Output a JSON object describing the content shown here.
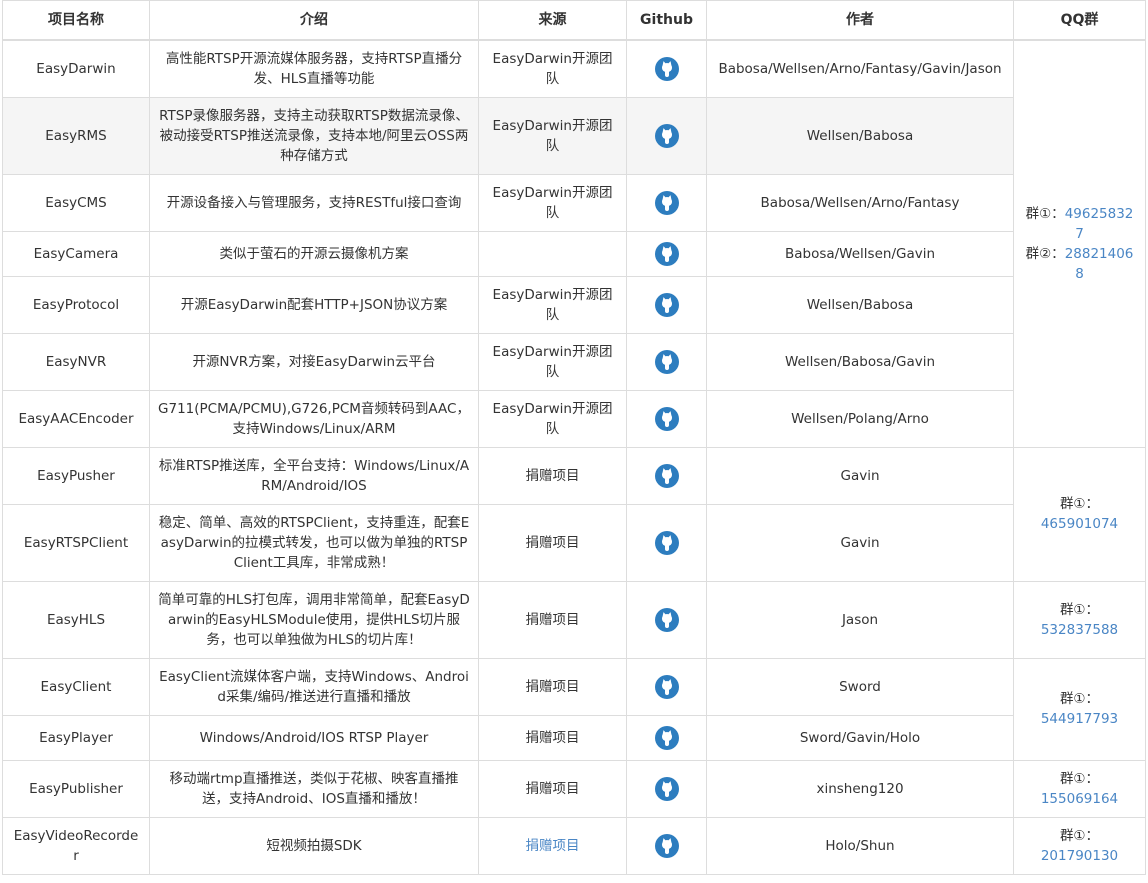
{
  "headers": [
    "项目名称",
    "介绍",
    "来源",
    "Github",
    "作者",
    "QQ群"
  ],
  "rows": [
    {
      "name": "EasyDarwin",
      "intro": "高性能RTSP开源流媒体服务器，支持RTSP直播分发、HLS直播等功能",
      "source": "EasyDarwin开源团队",
      "author": "Babosa/Wellsen/Arno/Fantasy/Gavin/Jason"
    },
    {
      "name": "EasyRMS",
      "intro": "RTSP录像服务器，支持主动获取RTSP数据流录像、被动接受RTSP推送流录像，支持本地/阿里云OSS两种存储方式",
      "source": "EasyDarwin开源团队",
      "author": "Wellsen/Babosa"
    },
    {
      "name": "EasyCMS",
      "intro": "开源设备接入与管理服务，支持RESTful接口查询",
      "source": "EasyDarwin开源团队",
      "author": "Babosa/Wellsen/Arno/Fantasy"
    },
    {
      "name": "EasyCamera",
      "intro": "类似于萤石的开源云摄像机方案",
      "source": "",
      "author": "Babosa/Wellsen/Gavin"
    },
    {
      "name": "EasyProtocol",
      "intro": "开源EasyDarwin配套HTTP+JSON协议方案",
      "source": "EasyDarwin开源团队",
      "author": "Wellsen/Babosa"
    },
    {
      "name": "EasyNVR",
      "intro": "开源NVR方案，对接EasyDarwin云平台",
      "source": "EasyDarwin开源团队",
      "author": "Wellsen/Babosa/Gavin"
    },
    {
      "name": "EasyAACEncoder",
      "intro": "G711(PCMA/PCMU),G726,PCM音频转码到AAC，支持Windows/Linux/ARM",
      "source": "EasyDarwin开源团队",
      "author": "Wellsen/Polang/Arno"
    },
    {
      "name": "EasyPusher",
      "intro": "标准RTSP推送库，全平台支持：Windows/Linux/ARM/Android/IOS",
      "source": "捐赠项目",
      "author": "Gavin"
    },
    {
      "name": "EasyRTSPClient",
      "intro": "稳定、简单、高效的RTSPClient，支持重连，配套EasyDarwin的拉模式转发，也可以做为单独的RTSPClient工具库，非常成熟！",
      "source": "捐赠项目",
      "author": "Gavin"
    },
    {
      "name": "EasyHLS",
      "intro": "简单可靠的HLS打包库，调用非常简单，配套EasyDarwin的EasyHLSModule使用，提供HLS切片服务，也可以单独做为HLS的切片库！",
      "source": "捐赠项目",
      "author": "Jason"
    },
    {
      "name": "EasyClient",
      "intro": "EasyClient流媒体客户端，支持Windows、Android采集/编码/推送进行直播和播放",
      "source": "捐赠项目",
      "author": "Sword"
    },
    {
      "name": "EasyPlayer",
      "intro": "Windows/Android/IOS RTSP Player",
      "source": "捐赠项目",
      "author": "Sword/Gavin/Holo"
    },
    {
      "name": "EasyPublisher",
      "intro": "移动端rtmp直播推送，类似于花椒、映客直播推送，支持Android、IOS直播和播放！",
      "source": "捐赠项目",
      "author": "xinsheng120"
    },
    {
      "name": "EasyVideoRecorder",
      "intro": "短视频拍摄SDK",
      "source": "捐赠项目",
      "author": "Holo/Shun"
    }
  ],
  "qq": {
    "g1": {
      "label1": "群①：",
      "num1": "496258327",
      "label2": "群②：",
      "num2": "288214068"
    },
    "g2": {
      "label": "群①：",
      "num": "465901074"
    },
    "g3": {
      "label": "群①：",
      "num": "532837588"
    },
    "g4": {
      "label": "群①：",
      "num": "544917793"
    },
    "g5": {
      "label": "群①：",
      "num": "155069164"
    },
    "g6": {
      "label": "群①：",
      "num": "201790130"
    }
  },
  "colors": {
    "link": "#4a86c5",
    "github_icon": "#2d7dbf",
    "alt_row": "#f5f5f5",
    "border": "#dddddd"
  }
}
